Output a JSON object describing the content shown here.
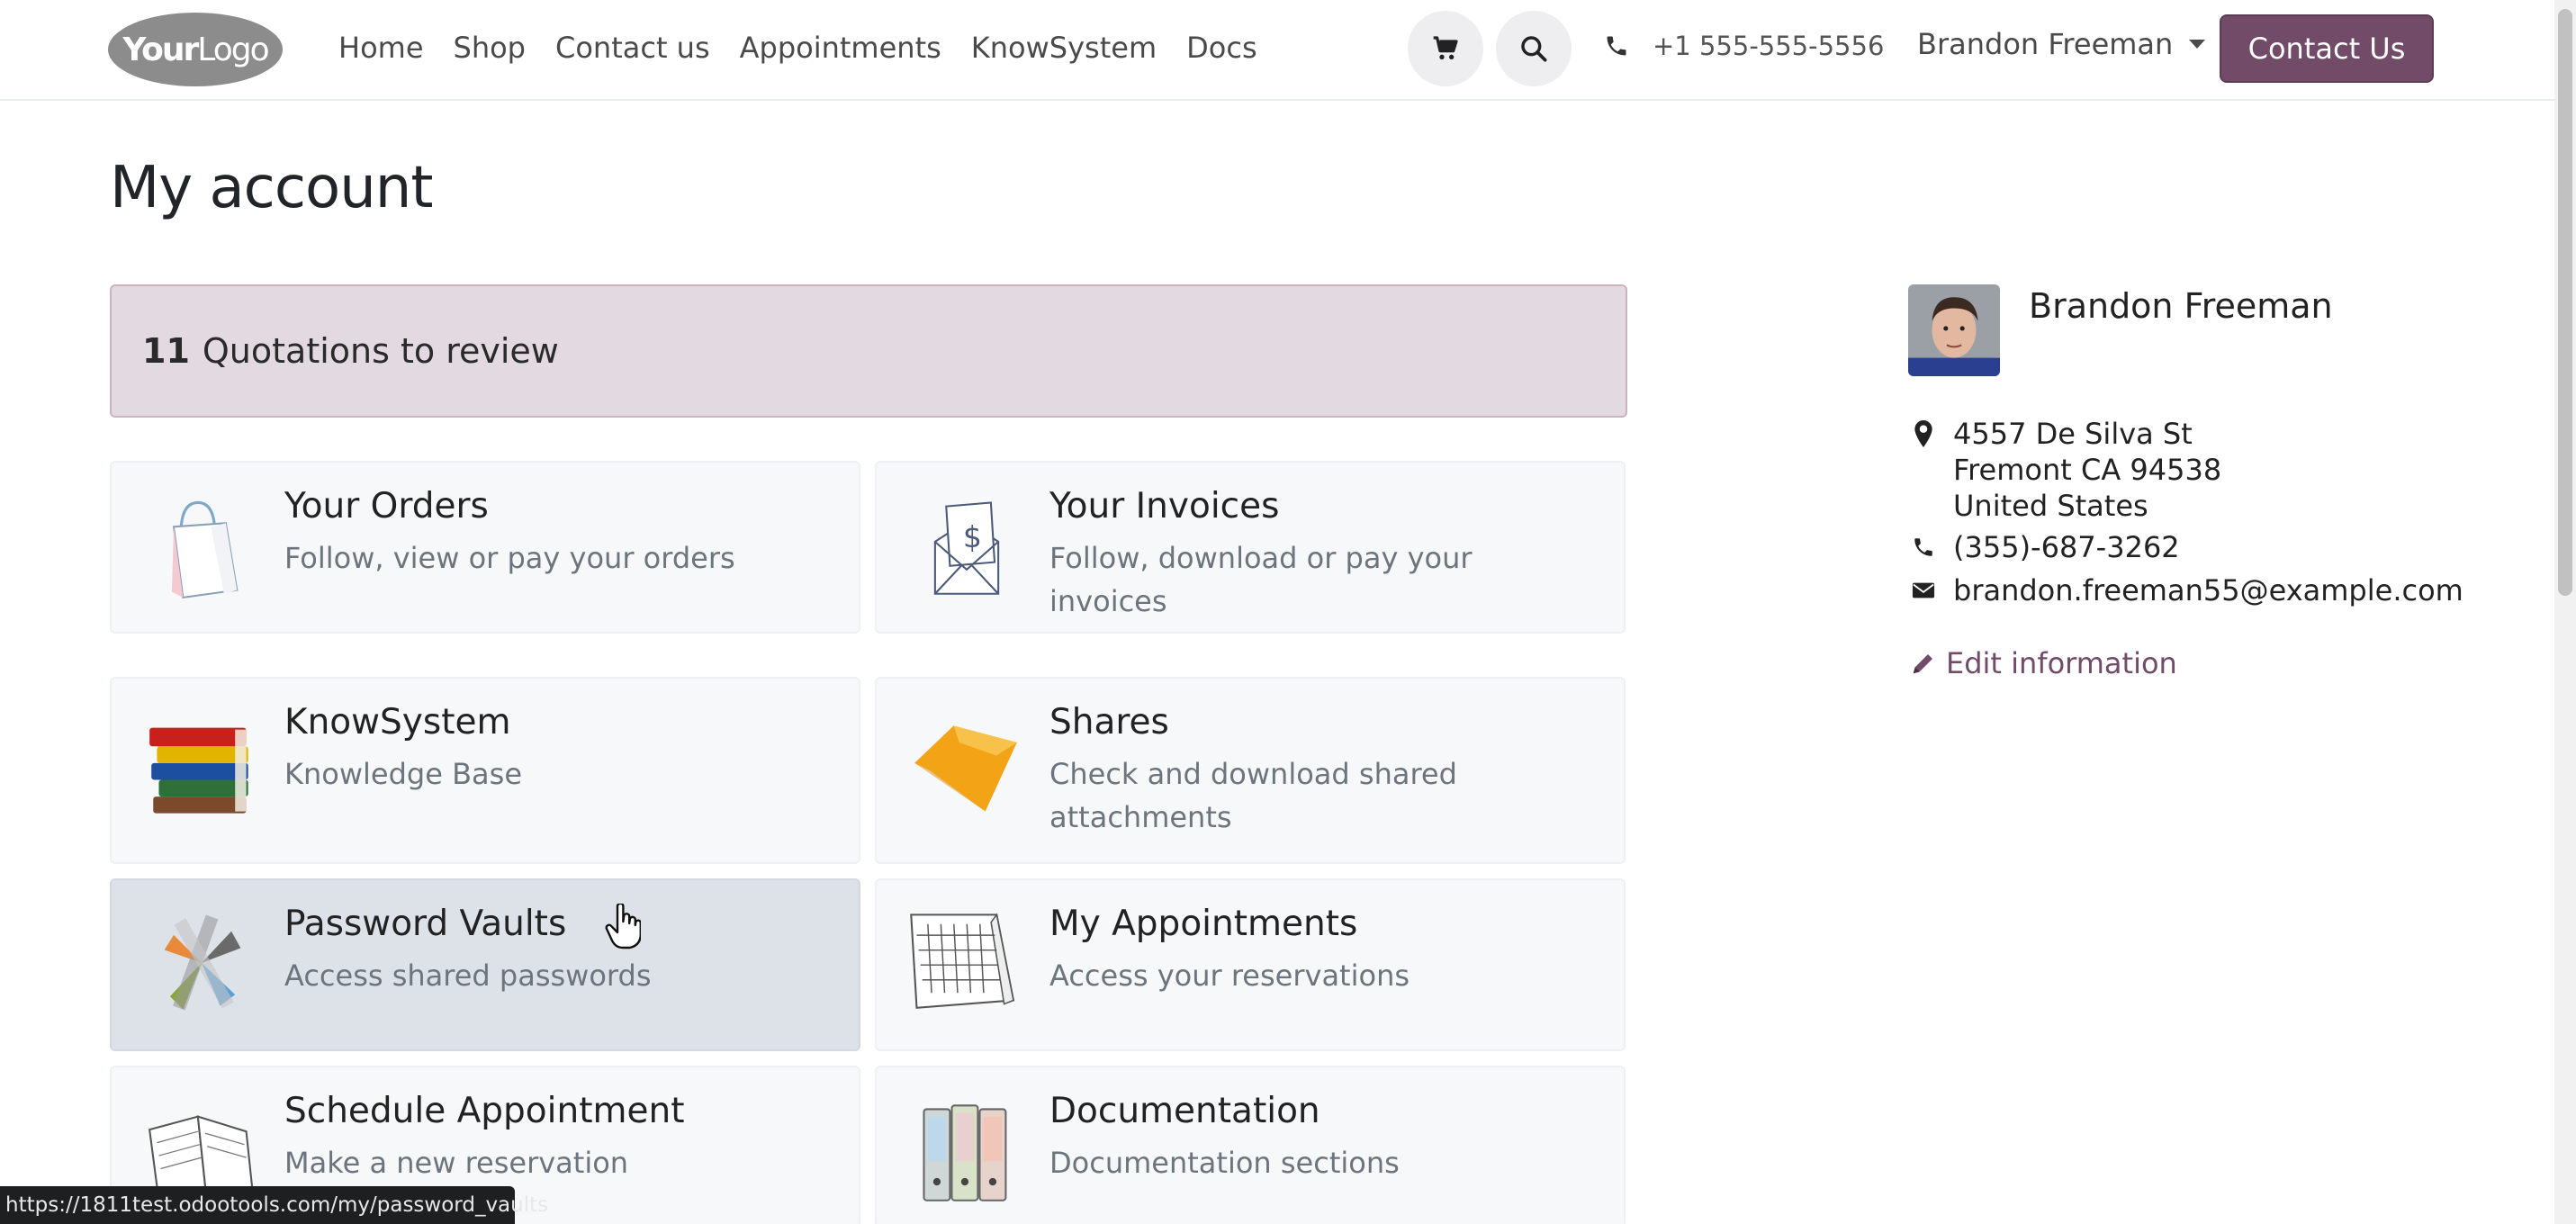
{
  "header": {
    "logo_bold": "Your",
    "logo_thin": "Logo",
    "nav": [
      "Home",
      "Shop",
      "Contact us",
      "Appointments",
      "KnowSystem",
      "Docs"
    ],
    "phone": "+1 555-555-5556",
    "user": "Brandon Freeman",
    "contact_button": "Contact Us"
  },
  "page": {
    "title": "My account"
  },
  "alert": {
    "count": "11",
    "text": "Quotations to review"
  },
  "cards": [
    {
      "title": "Your Orders",
      "desc": "Follow, view or pay your orders",
      "icon": "shopping-bag-icon"
    },
    {
      "title": "Your Invoices",
      "desc": "Follow, download or pay your invoices",
      "icon": "invoice-envelope-icon"
    },
    {
      "title": "KnowSystem",
      "desc": "Knowledge Base",
      "icon": "books-icon"
    },
    {
      "title": "Shares",
      "desc": "Check and download shared attachments",
      "icon": "shares-diamond-icon"
    },
    {
      "title": "Password Vaults",
      "desc": "Access shared passwords",
      "icon": "password-vault-icon"
    },
    {
      "title": "My Appointments",
      "desc": "Access your reservations",
      "icon": "calendar-icon"
    },
    {
      "title": "Schedule Appointment",
      "desc": "Make a new reservation",
      "icon": "open-book-icon"
    },
    {
      "title": "Documentation",
      "desc": "Documentation sections",
      "icon": "binders-icon"
    }
  ],
  "profile": {
    "name": "Brandon Freeman",
    "address_line1": "4557 De Silva St",
    "address_line2": "Fremont CA 94538",
    "address_line3": "United States",
    "phone": "(355)-687-3262",
    "email": "brandon.freeman55@example.com",
    "edit_label": "Edit information"
  },
  "status_url": "https://1811test.odootools.com/my/password_vaults",
  "colors": {
    "brand": "#714b67",
    "alert_bg": "#e2dae0",
    "card_bg": "#f7f8fa",
    "card_hover_bg": "#dde2e8"
  }
}
